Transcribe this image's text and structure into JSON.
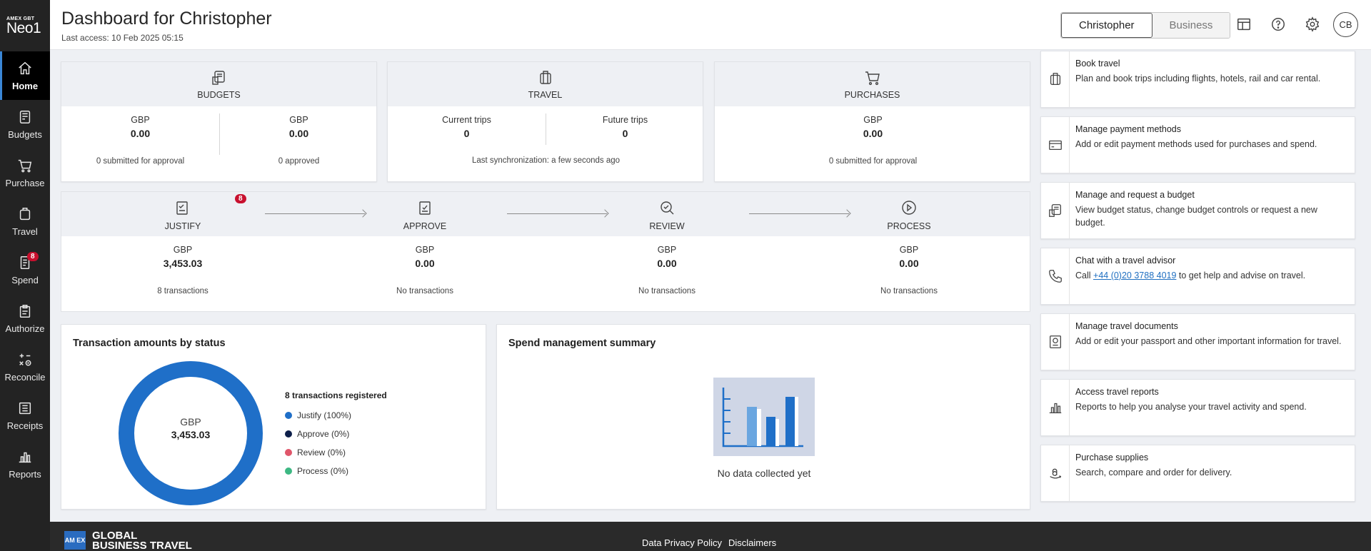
{
  "brand": {
    "small": "AMEX GBT",
    "big": "Neo1"
  },
  "sidebar": {
    "items": [
      {
        "label": "Home",
        "icon": "home-icon"
      },
      {
        "label": "Budgets",
        "icon": "budgets-icon"
      },
      {
        "label": "Purchase",
        "icon": "cart-icon"
      },
      {
        "label": "Travel",
        "icon": "suitcase-icon"
      },
      {
        "label": "Spend",
        "icon": "receipt-icon",
        "badge": "8"
      },
      {
        "label": "Authorize",
        "icon": "clipboard-icon"
      },
      {
        "label": "Reconcile",
        "icon": "calculator-icon"
      },
      {
        "label": "Receipts",
        "icon": "receipts-icon"
      },
      {
        "label": "Reports",
        "icon": "bar-chart-icon"
      }
    ]
  },
  "header": {
    "title": "Dashboard for Christopher",
    "last_access": "Last access: 10 Feb 2025 05:15",
    "toggle": {
      "personal": "Christopher",
      "business": "Business"
    },
    "avatar": "CB"
  },
  "cards": {
    "budgets": {
      "label": "BUDGETS",
      "left": {
        "currency": "GBP",
        "amount": "0.00",
        "note": "0 submitted for approval"
      },
      "right": {
        "currency": "GBP",
        "amount": "0.00",
        "note": "0 approved"
      }
    },
    "travel": {
      "label": "TRAVEL",
      "current_label": "Current trips",
      "current_value": "0",
      "future_label": "Future trips",
      "future_value": "0",
      "sync": "Last synchronization: a few seconds ago"
    },
    "purchases": {
      "label": "PURCHASES",
      "currency": "GBP",
      "amount": "0.00",
      "note": "0 submitted for approval"
    }
  },
  "workflow": [
    {
      "label": "JUSTIFY",
      "badge": "8",
      "currency": "GBP",
      "amount": "3,453.03",
      "note": "8 transactions"
    },
    {
      "label": "APPROVE",
      "currency": "GBP",
      "amount": "0.00",
      "note": "No transactions"
    },
    {
      "label": "REVIEW",
      "currency": "GBP",
      "amount": "0.00",
      "note": "No transactions"
    },
    {
      "label": "PROCESS",
      "currency": "GBP",
      "amount": "0.00",
      "note": "No transactions"
    }
  ],
  "status_chart": {
    "title": "Transaction amounts by status",
    "center_currency": "GBP",
    "center_amount": "3,453.03",
    "legend_title": "8 transactions registered",
    "legend": [
      {
        "label": "Justify (100%)",
        "color": "#1f6fc8"
      },
      {
        "label": "Approve (0%)",
        "color": "#0d1f4a"
      },
      {
        "label": "Review (0%)",
        "color": "#e0566a"
      },
      {
        "label": "Process (0%)",
        "color": "#3db883"
      }
    ]
  },
  "chart_data": {
    "type": "pie",
    "title": "Transaction amounts by status",
    "categories": [
      "Justify",
      "Approve",
      "Review",
      "Process"
    ],
    "values": [
      100,
      0,
      0,
      0
    ],
    "unit": "%"
  },
  "spend_summary": {
    "title": "Spend management summary",
    "empty_text": "No data collected yet"
  },
  "actions": [
    {
      "title": "Book travel",
      "desc": "Plan and book trips including flights, hotels, rail and car rental.",
      "icon": "luggage-icon"
    },
    {
      "title": "Manage payment methods",
      "desc": "Add or edit payment methods used for purchases and spend.",
      "icon": "credit-card-icon"
    },
    {
      "title": "Manage and request a budget",
      "desc": "View budget status, change budget controls or request a new budget.",
      "icon": "budget-icon"
    },
    {
      "title": "Chat with a travel advisor",
      "desc_pre": "Call ",
      "phone": "+44 (0)20 3788 4019",
      "desc_post": " to get help and advise on travel.",
      "icon": "phone-icon"
    },
    {
      "title": "Manage travel documents",
      "desc": "Add or edit your passport and other important information for travel.",
      "icon": "passport-icon"
    },
    {
      "title": "Access travel reports",
      "desc": "Reports to help you analyse your travel activity and spend.",
      "icon": "bar-chart-icon"
    },
    {
      "title": "Purchase supplies",
      "desc": "Search, compare and order for delivery.",
      "icon": "amazon-icon"
    }
  ],
  "footer": {
    "logo_box": "AM EX",
    "logo_line1": "GLOBAL",
    "logo_line2": "BUSINESS TRAVEL",
    "links": [
      "Data Privacy Policy",
      "Disclaimers"
    ]
  },
  "colors": {
    "sidebar": "#232323",
    "accent": "#1f6fc8",
    "badge": "#c8102e"
  }
}
